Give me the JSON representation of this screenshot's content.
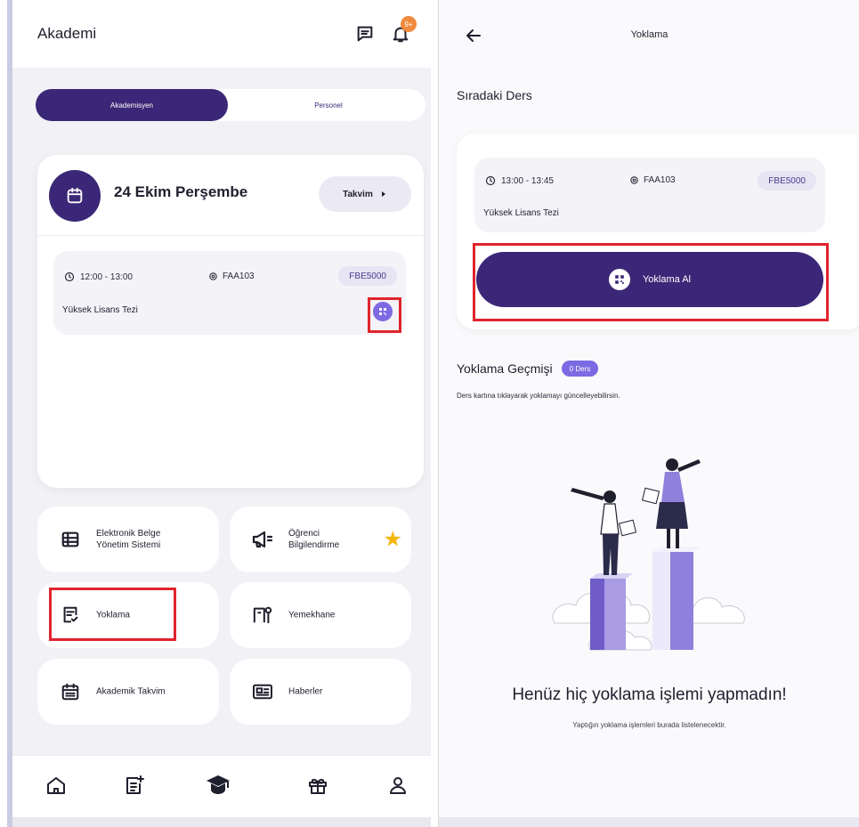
{
  "left": {
    "app_title": "Akademi",
    "notification_badge": "9+",
    "segments": {
      "active": "Akademisyen",
      "inactive": "Personel"
    },
    "today": {
      "title": "24 Ekim Perşembe",
      "calendar_button": "Takvim",
      "lesson": {
        "time": "12:00 - 13:00",
        "room": "FAA103",
        "code": "FBE5000",
        "name": "Yüksek Lisans Tezi"
      }
    },
    "menu": [
      {
        "label_line1": "Elektronik Belge",
        "label_line2": "Yönetim Sistemi",
        "icon": "table-icon"
      },
      {
        "label_line1": "Öğrenci",
        "label_line2": "Bilgilendirme",
        "icon": "megaphone-icon"
      },
      {
        "label_line1": "Yoklama",
        "label_line2": "",
        "icon": "checklist-icon"
      },
      {
        "label_line1": "Yemekhane",
        "label_line2": "",
        "icon": "dining-icon"
      },
      {
        "label_line1": "Akademik Takvim",
        "label_line2": "",
        "icon": "calendar-grid-icon"
      },
      {
        "label_line1": "Haberler",
        "label_line2": "",
        "icon": "news-icon"
      }
    ],
    "bottom_nav": [
      "home-icon",
      "notes-icon",
      "graduation-cap-icon",
      "gift-icon",
      "profile-icon"
    ]
  },
  "right": {
    "title": "Yoklama",
    "next_section": "Sıradaki Ders",
    "lesson": {
      "time": "13:00 - 13:45",
      "room": "FAA103",
      "code": "FBE5000",
      "name": "Yüksek Lisans Tezi"
    },
    "take_attendance_button": "Yoklama Al",
    "history_title": "Yoklama Geçmişi",
    "history_badge": "0 Ders",
    "history_hint": "Ders kartına tıklayarak yoklamayı güncelleyebilirsin.",
    "empty_title": "Henüz hiç yoklama işlemi yapmadın!",
    "empty_subtitle": "Yaptığın yoklama işlemleri burada listelenecektir."
  },
  "colors": {
    "primary": "#3b2777",
    "accent": "#7c6ae2",
    "highlight": "#e0242c",
    "star": "#f5b60b",
    "badge": "#f08a3c"
  }
}
